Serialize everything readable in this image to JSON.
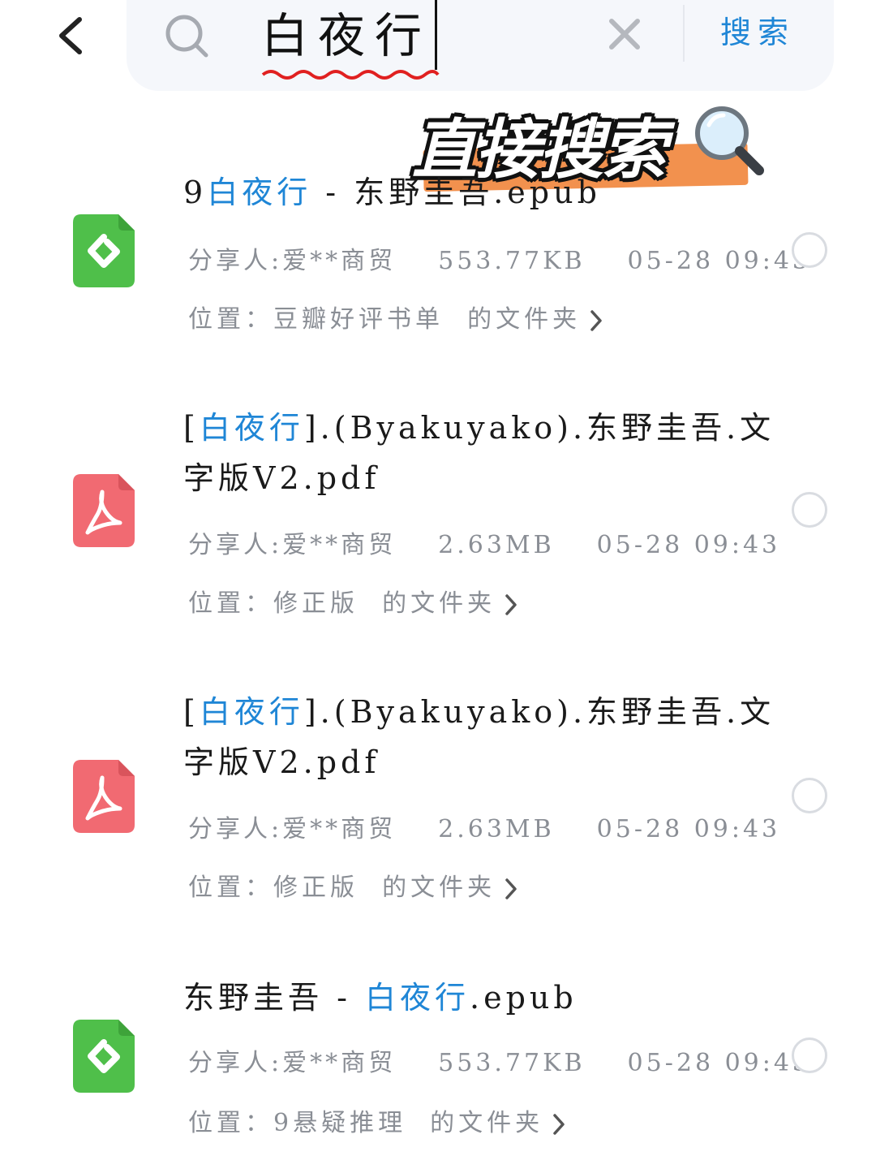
{
  "search": {
    "query": "白夜行",
    "button_label": "搜索"
  },
  "sticker": {
    "text": "直接搜索"
  },
  "icons": {
    "back": "chevron-left-icon",
    "search": "search-icon",
    "clear": "close-icon",
    "epub": "epub-file-icon",
    "pdf": "pdf-file-icon",
    "chevron": "chevron-right-icon",
    "magnifier": "magnifier-emoji-icon"
  },
  "colors": {
    "highlight": "#1f86d6",
    "epub_green": "#4fbf4a",
    "pdf_red": "#f16a72",
    "sticker_orange": "#f2914e"
  },
  "results": [
    {
      "name_pre": "9",
      "name_hl": "白夜行",
      "name_post": " - 东野圭吾.epub",
      "type": "epub",
      "sharer": "分享人:爱**商贸",
      "size": "553.77KB",
      "time": "05-28 09:43",
      "location_label": "位置：",
      "location_folder": "豆瓣好评书单",
      "location_suffix": "的文件夹"
    },
    {
      "name_pre": "[",
      "name_hl": "白夜行",
      "name_post": "].(Byakuyako).东野圭吾.文字版V2.pdf",
      "type": "pdf",
      "sharer": "分享人:爱**商贸",
      "size": "2.63MB",
      "time": "05-28 09:43",
      "location_label": "位置：",
      "location_folder": "修正版",
      "location_suffix": "的文件夹"
    },
    {
      "name_pre": "[",
      "name_hl": "白夜行",
      "name_post": "].(Byakuyako).东野圭吾.文字版V2.pdf",
      "type": "pdf",
      "sharer": "分享人:爱**商贸",
      "size": "2.63MB",
      "time": "05-28 09:43",
      "location_label": "位置：",
      "location_folder": "修正版",
      "location_suffix": "的文件夹"
    },
    {
      "name_pre": "东野圭吾 - ",
      "name_hl": "白夜行",
      "name_post": ".epub",
      "type": "epub",
      "sharer": "分享人:爱**商贸",
      "size": "553.77KB",
      "time": "05-28 09:43",
      "location_label": "位置：",
      "location_folder": "9悬疑推理",
      "location_suffix": "的文件夹"
    }
  ]
}
